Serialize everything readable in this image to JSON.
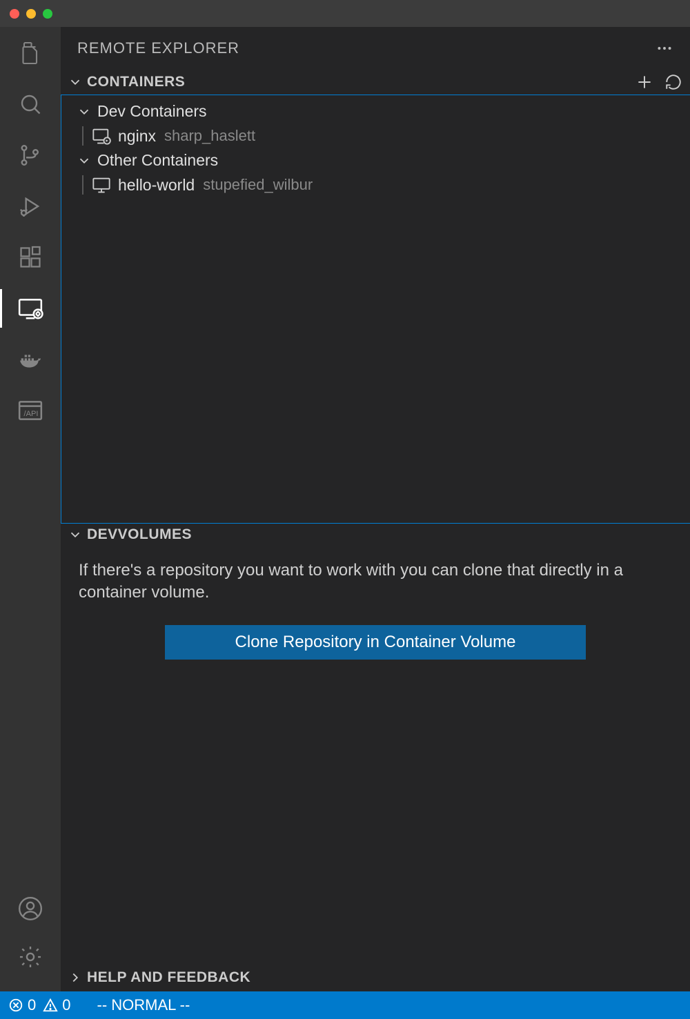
{
  "sidebar": {
    "title": "REMOTE EXPLORER"
  },
  "sections": {
    "containers": {
      "label": "CONTAINERS",
      "groups": [
        {
          "label": "Dev Containers"
        },
        {
          "label": "Other Containers"
        }
      ],
      "dev_items": [
        {
          "primary": "nginx",
          "secondary": "sharp_haslett"
        }
      ],
      "other_items": [
        {
          "primary": "hello-world",
          "secondary": "stupefied_wilbur"
        }
      ]
    },
    "devvolumes": {
      "label": "DEVVOLUMES",
      "desc": "If there's a repository you want to work with you can clone that directly in a container volume.",
      "button": "Clone Repository in Container Volume"
    },
    "help": {
      "label": "HELP AND FEEDBACK"
    }
  },
  "statusbar": {
    "errors": "0",
    "warnings": "0",
    "mode": "-- NORMAL --"
  }
}
